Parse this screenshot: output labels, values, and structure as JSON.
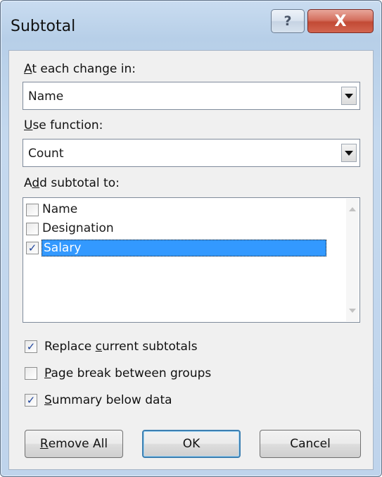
{
  "window": {
    "title": "Subtotal",
    "help_glyph": "?",
    "close_glyph": "X"
  },
  "at_each_change": {
    "label_mnemonic": "A",
    "label_rest": "t each change in:",
    "value": "Name"
  },
  "use_function": {
    "label_mnemonic": "U",
    "label_rest": "se function:",
    "value": "Count"
  },
  "add_subtotal": {
    "label_pre": "A",
    "label_mnemonic": "d",
    "label_rest": "d subtotal to:",
    "items": [
      {
        "label": "Name",
        "checked": false,
        "selected": false
      },
      {
        "label": "Designation",
        "checked": false,
        "selected": false
      },
      {
        "label": "Salary",
        "checked": true,
        "selected": true
      }
    ]
  },
  "options": {
    "replace": {
      "pre": "Replace ",
      "mnemonic": "c",
      "rest": "urrent subtotals",
      "checked": true
    },
    "page_break": {
      "pre": "",
      "mnemonic": "P",
      "rest": "age break between groups",
      "checked": false
    },
    "summary": {
      "pre": "",
      "mnemonic": "S",
      "rest": "ummary below data",
      "checked": true
    }
  },
  "buttons": {
    "remove_all": {
      "mnemonic": "R",
      "rest": "emove All"
    },
    "ok": "OK",
    "cancel": "Cancel"
  },
  "colors": {
    "selection": "#3399ff",
    "dialog_bg": "#f0f0f0",
    "frame": "#bfd4ec",
    "close_red": "#c24a35"
  }
}
